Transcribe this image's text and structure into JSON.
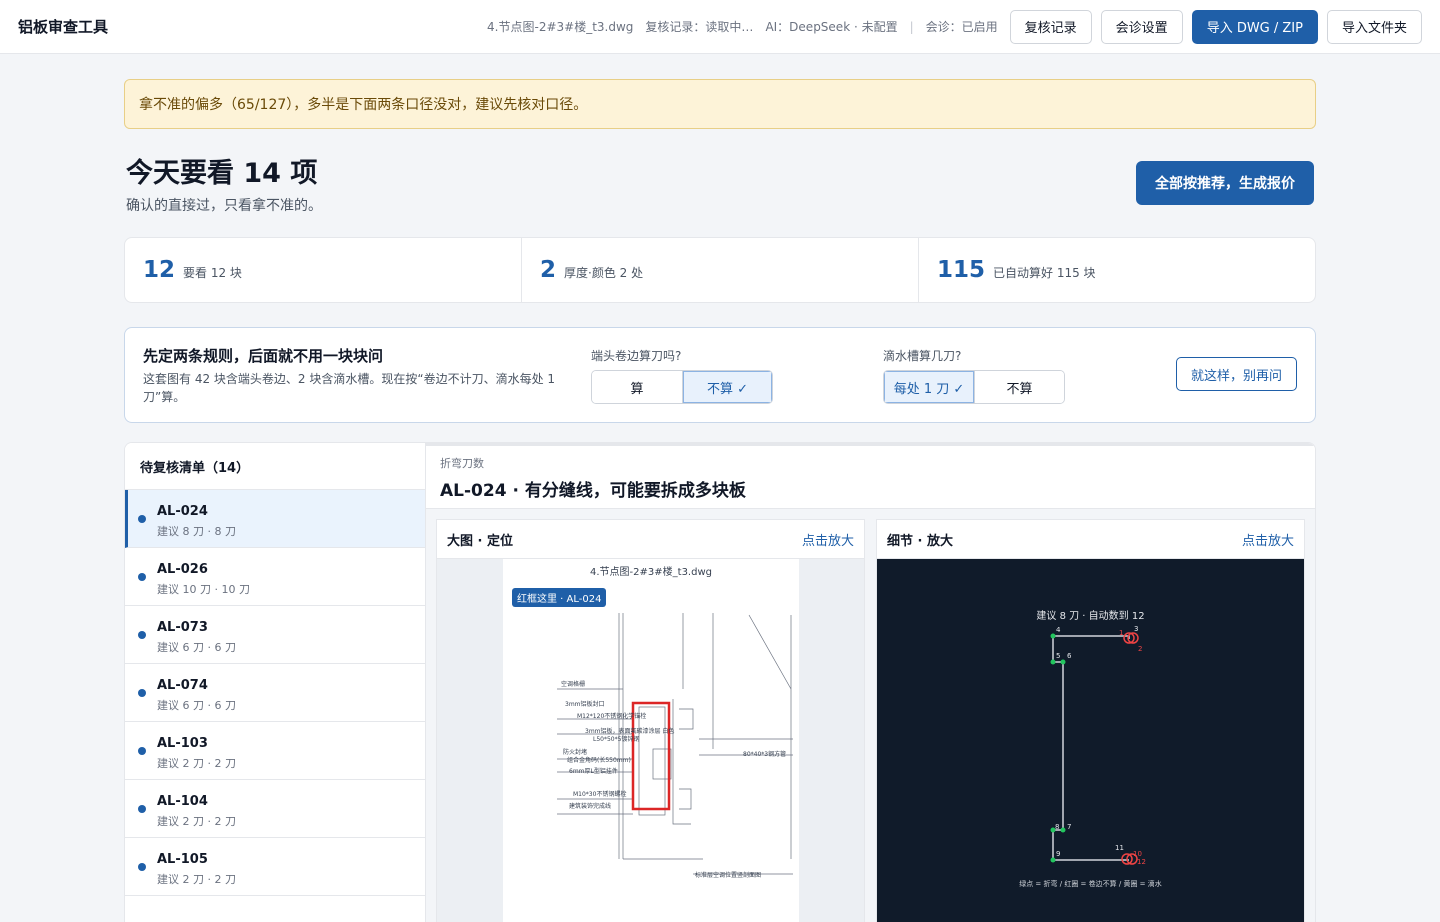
{
  "header": {
    "app_title": "铝板审查工具",
    "file_name": "4.节点图-2#3#楼_t3.dwg",
    "review_status": "复核记录：读取中…",
    "ai_status": "AI：DeepSeek · 未配置",
    "separator": "|",
    "consult_status": "会诊：已启用",
    "buttons": {
      "review_log": "复核记录",
      "consult_settings": "会诊设置",
      "import_dwg": "导入 DWG / ZIP",
      "import_folder": "导入文件夹"
    }
  },
  "alert": {
    "text": "拿不准的偏多（65/127），多半是下面两条口径没对，建议先核对口径。"
  },
  "hero": {
    "title": "今天要看 14 项",
    "subtitle": "确认的直接过，只看拿不准的。",
    "cta": "全部按推荐，生成报价"
  },
  "stats": [
    {
      "value": "12",
      "label": "要看 12 块"
    },
    {
      "value": "2",
      "label": "厚度·颜色 2 处"
    },
    {
      "value": "115",
      "label": "已自动算好 115 块"
    }
  ],
  "rules": {
    "title": "先定两条规则，后面就不用一块块问",
    "description": "这套图有 42 块含端头卷边、2 块含滴水槽。现在按“卷边不计刀、滴水每处 1 刀”算。",
    "q1": {
      "label": "端头卷边算刀吗?",
      "options": [
        "算",
        "不算 ✓"
      ],
      "selected": 1
    },
    "q2": {
      "label": "滴水槽算几刀?",
      "options": [
        "每处 1 刀 ✓",
        "不算"
      ],
      "selected": 0
    },
    "confirm": "就这样，别再问"
  },
  "review_list": {
    "title": "待复核清单（14）",
    "items": [
      {
        "id": "AL-024",
        "sub": "建议 8 刀 · 8 刀"
      },
      {
        "id": "AL-026",
        "sub": "建议 10 刀 · 10 刀"
      },
      {
        "id": "AL-073",
        "sub": "建议 6 刀 · 6 刀"
      },
      {
        "id": "AL-074",
        "sub": "建议 6 刀 · 6 刀"
      },
      {
        "id": "AL-103",
        "sub": "建议 2 刀 · 2 刀"
      },
      {
        "id": "AL-104",
        "sub": "建议 2 刀 · 2 刀"
      },
      {
        "id": "AL-105",
        "sub": "建议 2 刀 · 2 刀"
      }
    ]
  },
  "detail": {
    "tag": "折弯刀数",
    "title": "AL-024 · 有分缝线，可能要拆成多块板",
    "overview": {
      "title": "大图 · 定位",
      "zoom_link": "点击放大",
      "sheet_title": "4.节点图-2#3#楼_t3.dwg",
      "pin_label": "红框这里 · AL-024",
      "labels": [
        "空调格栅",
        "3mm铝板封口",
        "M12*120不锈钢化学锚栓",
        "3mm铝板，表面氟碳漆涂层 白色",
        "L50*50*5镀锌钢",
        "防火封堵",
        "组合金角码(长550mm)",
        "6mm厚L型铝挂件",
        "80*40*3钢方管",
        "M10*30不锈钢螺栓",
        "建筑装饰完成线",
        "标准层空调位置竖剖面图"
      ]
    },
    "zoom": {
      "title": "细节 · 放大",
      "zoom_link": "点击放大",
      "caption": "建议 8 刀 · 自动数到 12",
      "legend": "绿点 = 折弯  /  红圈 = 卷边不算  /  黄圈 = 滴水",
      "points": [
        "1",
        "2",
        "3",
        "4",
        "5",
        "6",
        "7",
        "8",
        "9",
        "10",
        "11",
        "12"
      ]
    }
  },
  "colors": {
    "primary": "#1f5fa8",
    "alert_bg": "#fdf3d8",
    "bend_point": "#22c55e",
    "hem_circle": "#ef4444",
    "highlight_box": "#dc2626"
  }
}
